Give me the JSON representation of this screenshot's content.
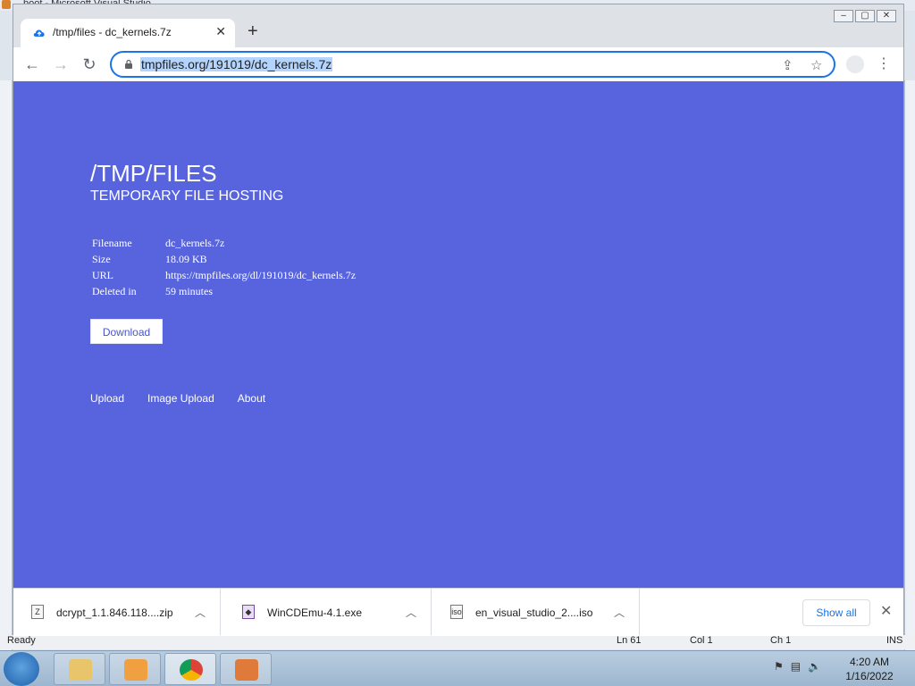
{
  "background": {
    "vs_title": "boot - Microsoft Visual Studio",
    "status": {
      "ready": "Ready",
      "ln": "Ln 61",
      "col": "Col 1",
      "ch": "Ch 1",
      "ins": "INS"
    }
  },
  "browser": {
    "tab_title": "/tmp/files - dc_kernels.7z",
    "url": "tmpfiles.org/191019/dc_kernels.7z"
  },
  "page": {
    "title": "/TMP/FILES",
    "subtitle": "TEMPORARY FILE HOSTING",
    "info": [
      {
        "key": "Filename",
        "value": "dc_kernels.7z"
      },
      {
        "key": "Size",
        "value": "18.09 KB"
      },
      {
        "key": "URL",
        "value": "https://tmpfiles.org/dl/191019/dc_kernels.7z"
      },
      {
        "key": "Deleted in",
        "value": "59 minutes"
      }
    ],
    "download_label": "Download",
    "links": [
      "Upload",
      "Image Upload",
      "About"
    ],
    "colors": {
      "background": "#5764dd"
    }
  },
  "downloads": {
    "items": [
      {
        "name": "dcrypt_1.1.846.118....zip",
        "icon": "zip-file-icon"
      },
      {
        "name": "WinCDEmu-4.1.exe",
        "icon": "installer-icon"
      },
      {
        "name": "en_visual_studio_2....iso",
        "icon": "iso-file-icon"
      }
    ],
    "show_all": "Show all"
  },
  "taskbar": {
    "time": "4:20 AM",
    "date": "1/16/2022"
  }
}
